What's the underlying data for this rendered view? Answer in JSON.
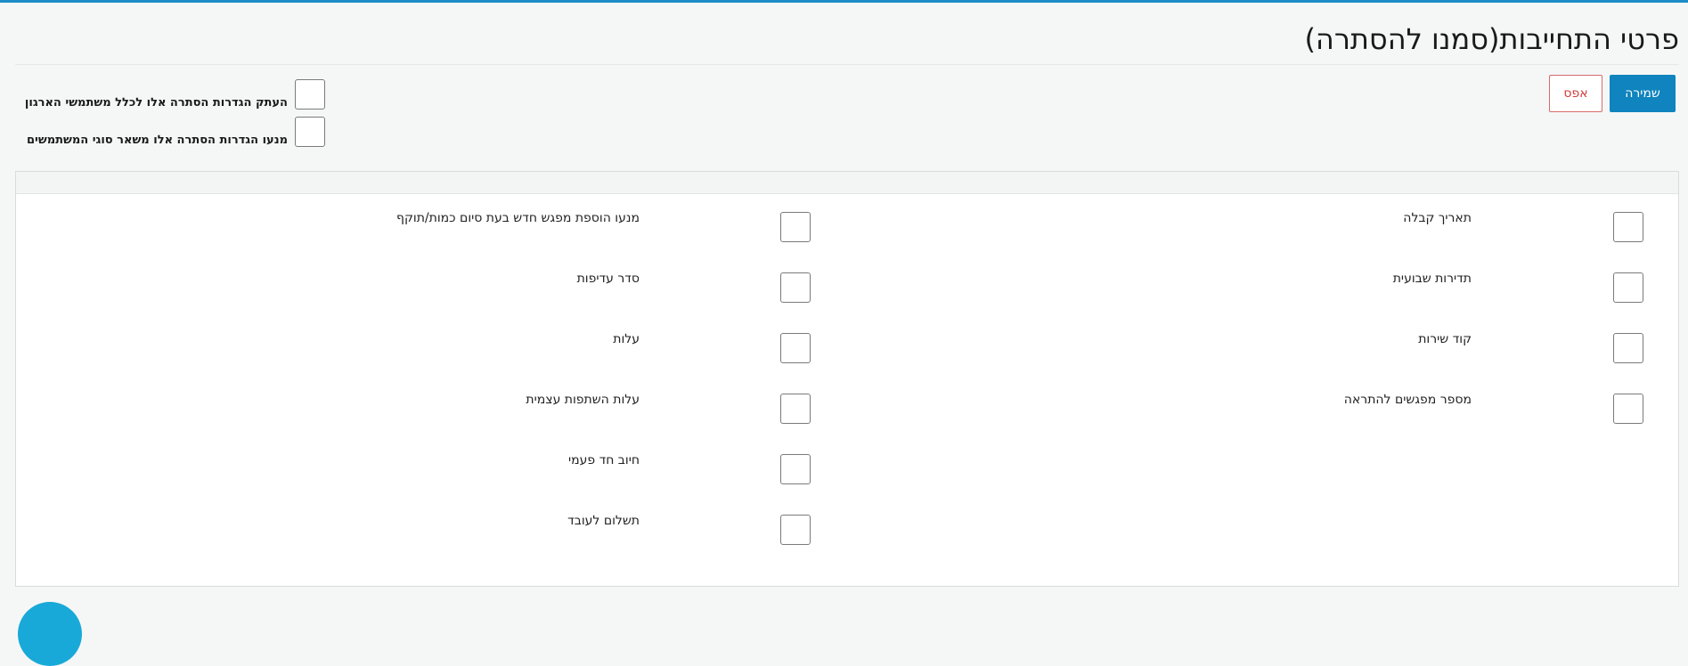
{
  "header": {
    "title": "פרטי התחייבות(סמנו להסתרה)"
  },
  "actions": {
    "save_label": "שמירה",
    "reset_label": "אפס"
  },
  "options": {
    "copy_to_org_label": "העתק הגדרות הסתרה אלו לכלל משתמשי הארגון",
    "prevent_other_types_label": "מנעו הגדרות הסתרה אלו משאר סוגי המשתמשים"
  },
  "fields": {
    "right": [
      "תאריך קבלה",
      "תדירות שבועית",
      "קוד שירות",
      "מספר מפגשים להתראה"
    ],
    "left": [
      "מנעו הוספת מפגש חדש בעת סיום כמות/תוקף",
      "סדר עדיפות",
      "עלות",
      "עלות השתפות עצמית",
      "חיוב חד פעמי",
      "תשלום לעובד"
    ]
  },
  "colors": {
    "accent": "#1d8cc6",
    "save_button": "#0f84be",
    "reset_text": "#d23a3a",
    "help_bubble": "#18a9d8"
  }
}
